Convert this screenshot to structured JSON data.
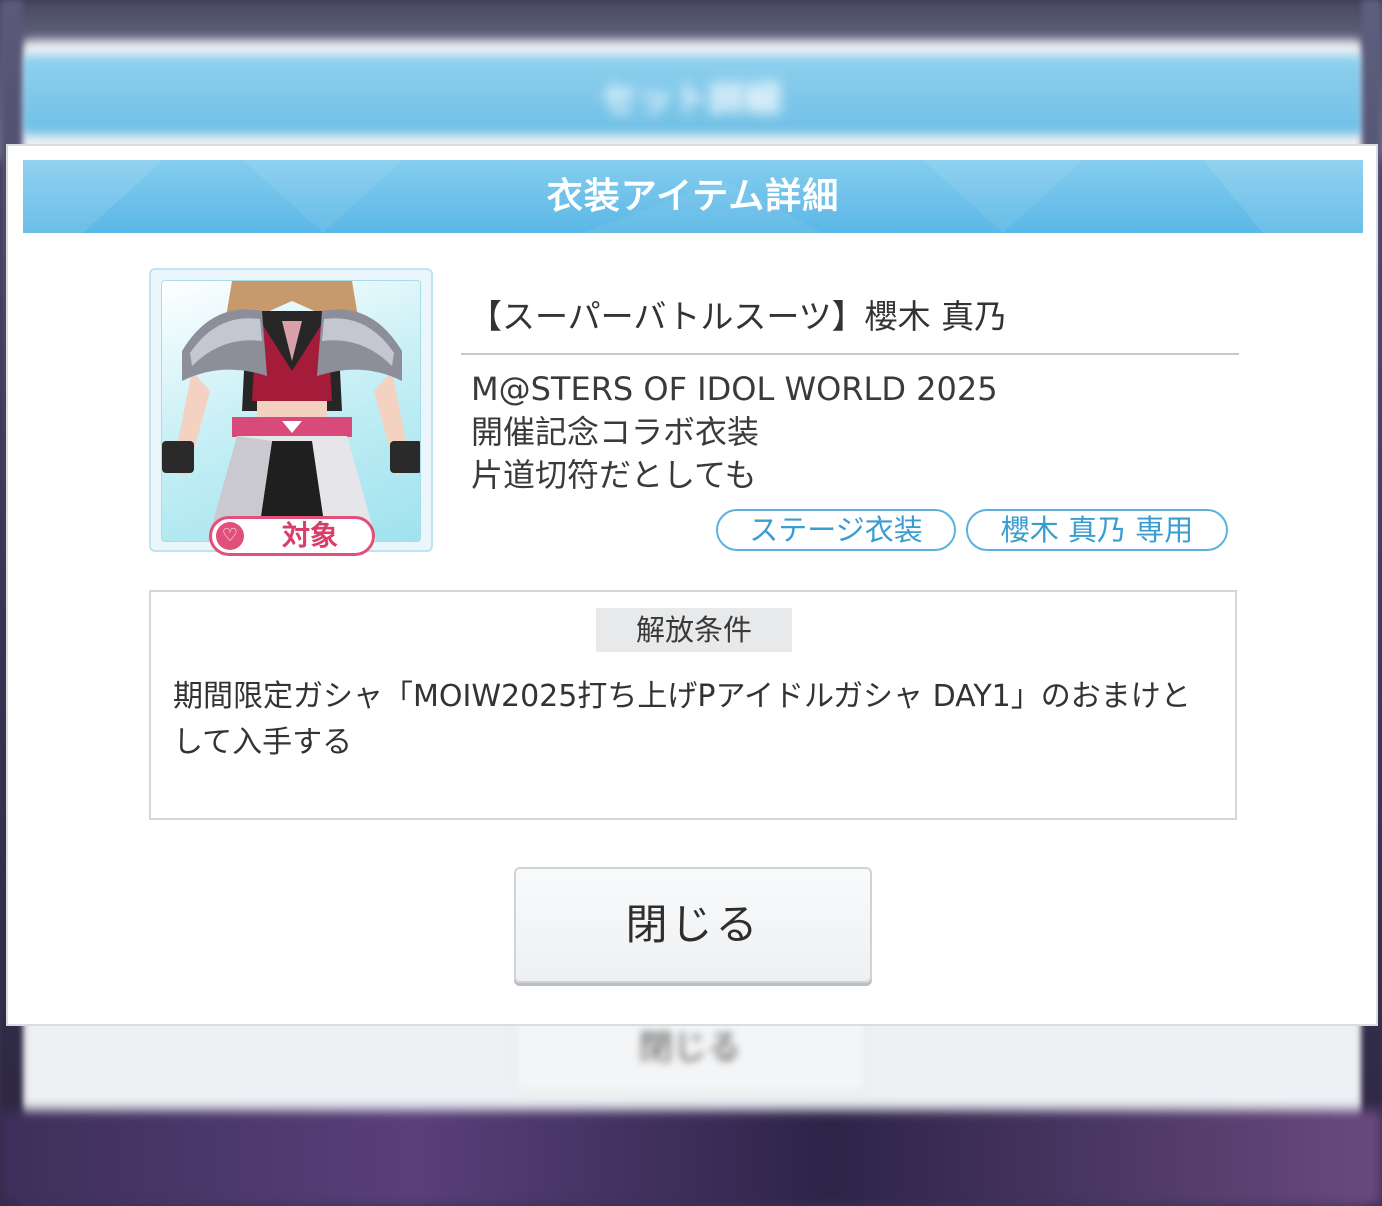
{
  "background": {
    "panel_title": "セット詳細",
    "button_label": "閉じる"
  },
  "modal": {
    "title": "衣装アイテム詳細",
    "item": {
      "name": "【スーパーバトルスーツ】櫻木 真乃",
      "description_lines": [
        "M@STERS OF IDOL WORLD 2025",
        "開催記念コラボ衣装",
        "片道切符だとしても"
      ],
      "target_badge": "対象",
      "thumbnail_icon": "costume-thumbnail"
    },
    "tags": {
      "type": "ステージ衣装",
      "character": "櫻木 真乃 専用"
    },
    "unlock": {
      "heading": "解放条件",
      "text": "期間限定ガシャ「MOIW2025打ち上げPアイドルガシャ DAY1」のおまけとして入手する"
    },
    "close_button": "閉じる"
  },
  "colors": {
    "header_blue": "#5ab7e6",
    "tag_blue": "#3a9dd0",
    "badge_pink": "#e0507a"
  }
}
